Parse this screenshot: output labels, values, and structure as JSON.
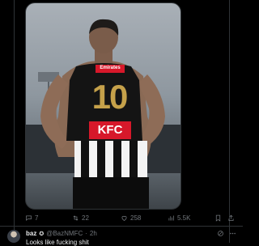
{
  "tweet": {
    "media": {
      "sponsor_top": "Emirates",
      "jersey_number": "10",
      "sponsor_front": "KFC"
    },
    "actions": {
      "replies": "7",
      "retweets": "22",
      "likes": "258",
      "views": "5.5K"
    }
  },
  "reply": {
    "name": "baz",
    "badge": "✪",
    "handle": "@BazNMFC",
    "separator": "·",
    "time": "2h",
    "text": "Looks like fucking shit"
  },
  "colors": {
    "background": "#000000",
    "muted_text": "#71767b",
    "divider": "#2f3336",
    "kfc_red": "#d7182a",
    "number_gold": "#c5a14a"
  },
  "icons": [
    "reply-icon",
    "retweet-icon",
    "like-icon",
    "views-icon",
    "bookmark-icon",
    "share-icon",
    "grok-icon",
    "more-icon"
  ]
}
